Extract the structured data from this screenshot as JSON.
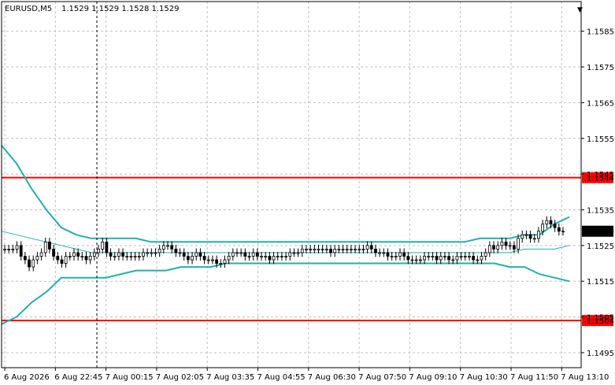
{
  "window": {
    "symbol_title": "EURUSD,M5",
    "ohlc_text": "1.1529 1.1529 1.1528 1.1529",
    "chevron": "▼"
  },
  "chart_data": {
    "type": "candlestick",
    "title": "EURUSD,M5",
    "ylim": [
      1.14908,
      1.15933
    ],
    "y_ticks": [
      "1.1585",
      "1.1575",
      "1.1565",
      "1.1555",
      "1.1545",
      "1.1535",
      "1.1525",
      "1.1515",
      "1.1505",
      "1.1495"
    ],
    "x_ticks": [
      "6 Aug 2026",
      "6 Aug 22:45",
      "7 Aug 00:15",
      "7 Aug 02:05",
      "7 Aug 03:35",
      "7 Aug 04:55",
      "7 Aug 06:30",
      "7 Aug 07:50",
      "7 Aug 09:10",
      "7 Aug 10:30",
      "7 Aug 11:50",
      "7 Aug 13:10"
    ],
    "grid": true,
    "levels": [
      {
        "value": 1.1544,
        "label": "1.1544",
        "color": "#ff0000"
      },
      {
        "value": 1.1504,
        "label": "1.1504",
        "color": "#ff0000"
      }
    ],
    "current_price": {
      "value": 1.1529,
      "label": "1.1529"
    },
    "colors": {
      "candles": "#000000",
      "bands": "#20b2aa",
      "mid": "#20b2aa",
      "level": "#ff0000",
      "grid": "#c0c0c0",
      "price_box": "#000000"
    },
    "candles_close": [
      1.1524,
      1.1524,
      1.1524,
      1.1525,
      1.1522,
      1.1521,
      1.1519,
      1.1521,
      1.1522,
      1.1523,
      1.1526,
      1.1524,
      1.1522,
      1.1521,
      1.152,
      1.1522,
      1.1522,
      1.1523,
      1.1522,
      1.1522,
      1.1521,
      1.1522,
      1.1523,
      1.1524,
      1.1526,
      1.1523,
      1.1522,
      1.1522,
      1.1523,
      1.1522,
      1.1522,
      1.1522,
      1.1522,
      1.1522,
      1.1523,
      1.1523,
      1.1523,
      1.1523,
      1.1524,
      1.1525,
      1.1525,
      1.1524,
      1.1523,
      1.1523,
      1.1522,
      1.1521,
      1.1522,
      1.1523,
      1.1522,
      1.1521,
      1.1521,
      1.1521,
      1.152,
      1.152,
      1.1521,
      1.1522,
      1.1523,
      1.1523,
      1.1523,
      1.1522,
      1.1522,
      1.1523,
      1.1522,
      1.1522,
      1.1522,
      1.1521,
      1.1522,
      1.1522,
      1.1522,
      1.1522,
      1.1523,
      1.1523,
      1.1523,
      1.1524,
      1.1524,
      1.1524,
      1.1524,
      1.1524,
      1.1524,
      1.1524,
      1.1523,
      1.1524,
      1.1524,
      1.1524,
      1.1524,
      1.1524,
      1.1524,
      1.1524,
      1.1524,
      1.1525,
      1.1524,
      1.1523,
      1.1523,
      1.1523,
      1.1522,
      1.1522,
      1.1522,
      1.1523,
      1.1522,
      1.1521,
      1.1521,
      1.1521,
      1.1521,
      1.1522,
      1.1522,
      1.1522,
      1.1521,
      1.1522,
      1.1522,
      1.1521,
      1.1521,
      1.1522,
      1.1522,
      1.1522,
      1.1522,
      1.1521,
      1.1521,
      1.1522,
      1.1523,
      1.1525,
      1.1524,
      1.1525,
      1.1526,
      1.1525,
      1.1525,
      1.1524,
      1.1527,
      1.1528,
      1.1528,
      1.1527,
      1.1527,
      1.1529,
      1.1531,
      1.1532,
      1.1531,
      1.153,
      1.1529,
      1.1529
    ],
    "upper_band": [
      1.1553,
      1.1548,
      1.1541,
      1.1535,
      1.153,
      1.1528,
      1.1527,
      1.1527,
      1.1527,
      1.1527,
      1.1526,
      1.1526,
      1.1526,
      1.1526,
      1.1526,
      1.1526,
      1.1526,
      1.1526,
      1.1526,
      1.1526,
      1.1526,
      1.1526,
      1.1526,
      1.1526,
      1.1526,
      1.1526,
      1.1526,
      1.1526,
      1.1526,
      1.1526,
      1.1526,
      1.1526,
      1.1527,
      1.1527,
      1.1527,
      1.1528,
      1.1528,
      1.1531,
      1.1533
    ],
    "mid_band": [
      1.1529,
      1.1528,
      1.1527,
      1.1526,
      1.1525,
      1.1524,
      1.1523,
      1.1523,
      1.1523,
      1.1523,
      1.1523,
      1.1523,
      1.1523,
      1.1523,
      1.1523,
      1.1523,
      1.1523,
      1.1523,
      1.1523,
      1.1523,
      1.1523,
      1.1523,
      1.1523,
      1.1523,
      1.1523,
      1.1523,
      1.1523,
      1.1523,
      1.1523,
      1.1523,
      1.1523,
      1.1523,
      1.1523,
      1.1523,
      1.1523,
      1.1524,
      1.1524,
      1.1524,
      1.1525
    ],
    "lower_band": [
      1.1503,
      1.1505,
      1.1509,
      1.1512,
      1.1516,
      1.1516,
      1.1516,
      1.1516,
      1.1517,
      1.1518,
      1.1518,
      1.1518,
      1.1519,
      1.1519,
      1.1519,
      1.152,
      1.152,
      1.152,
      1.152,
      1.152,
      1.152,
      1.152,
      1.152,
      1.152,
      1.152,
      1.152,
      1.152,
      1.152,
      1.152,
      1.152,
      1.152,
      1.152,
      1.152,
      1.152,
      1.1519,
      1.1519,
      1.1517,
      1.1516,
      1.1515
    ]
  }
}
